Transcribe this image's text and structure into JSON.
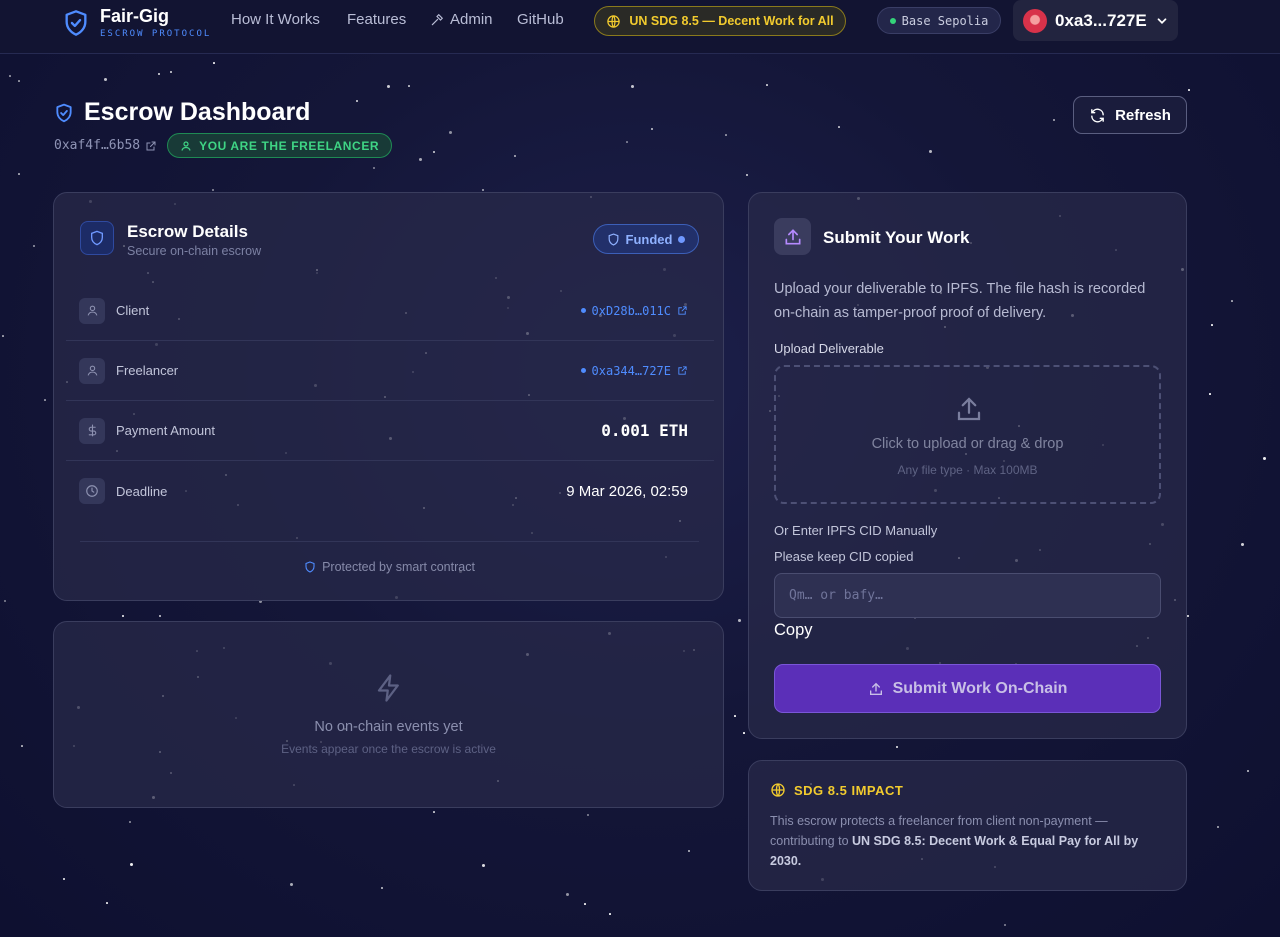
{
  "nav": {
    "brand_name": "Fair-Gig",
    "brand_sub": "ESCROW PROTOCOL",
    "links": [
      "How It Works",
      "Features",
      "Admin",
      "GitHub"
    ],
    "sdg_pill": "UN SDG 8.5 — Decent Work for All",
    "network": "Base Sepolia",
    "wallet": "0xa3...727E",
    "colors": {
      "accent_blue": "#4f8cff",
      "sdg_gold": "#f2cb2e",
      "network_green": "#34d37a"
    }
  },
  "header": {
    "title": "Escrow Dashboard",
    "address": "0xaf4f…6b58",
    "role": "YOU ARE THE FREELANCER",
    "refresh_label": "Refresh"
  },
  "details": {
    "title": "Escrow Details",
    "subtitle": "Secure on-chain escrow",
    "status": "Funded",
    "rows": [
      {
        "label": "Client",
        "value": "0xD28b…011C",
        "icon": "user-icon"
      },
      {
        "label": "Freelancer",
        "value": "0xa344…727E",
        "icon": "user-icon"
      },
      {
        "label": "Payment Amount",
        "value": "0.001 ETH",
        "icon": "dollar-icon"
      },
      {
        "label": "Deadline",
        "value": "9 Mar 2026, 02:59",
        "icon": "clock-icon"
      }
    ],
    "footer": "Protected by smart contract"
  },
  "events": {
    "title": "No on-chain events yet",
    "subtitle": "Events appear once the escrow is active"
  },
  "submit": {
    "title": "Submit Your Work",
    "description": "Upload your deliverable to IPFS. The file hash is recorded on-chain as tamper-proof proof of delivery.",
    "upload_label": "Upload Deliverable",
    "drop_title": "Click to upload or drag & drop",
    "drop_sub": "Any file type · Max 100MB",
    "cid_label": "Or Enter IPFS CID Manually",
    "cid_keep": "Please keep CID copied",
    "cid_placeholder": "Qm… or bafy…",
    "copy_label": "Copy",
    "button_label": "Submit Work On-Chain"
  },
  "impact": {
    "title": "SDG 8.5 IMPACT",
    "text_before": "This escrow protects a freelancer from client non-payment — contributing to ",
    "text_bold": "UN SDG 8.5: Decent Work & Equal Pay for All by 2030."
  }
}
